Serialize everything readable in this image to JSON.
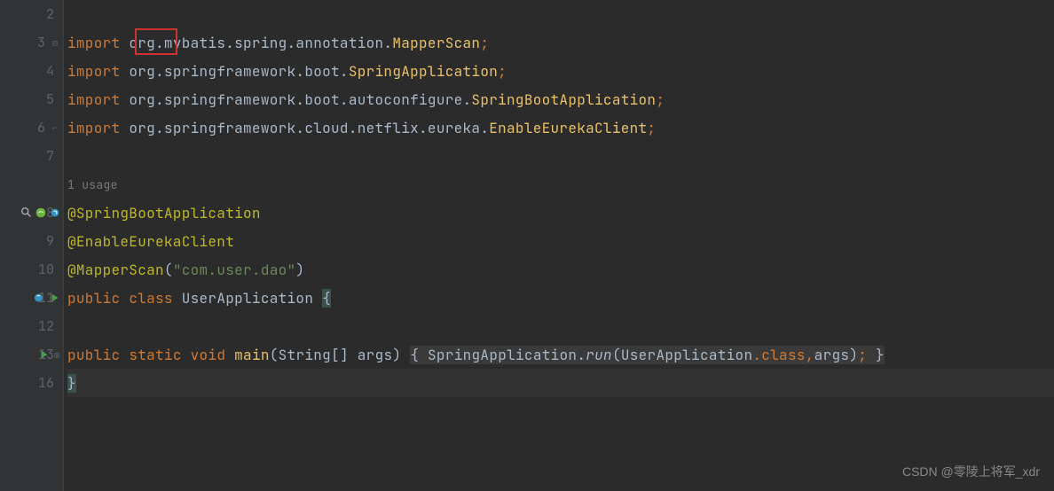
{
  "lines": [
    {
      "num": "2",
      "content": ""
    },
    {
      "num": "3",
      "content": "import_line",
      "parts": [
        "import ",
        "org",
        ".mybatis.spring.annotation.",
        "MapperScan",
        ";"
      ],
      "fold": "minus"
    },
    {
      "num": "4",
      "content": "import_line",
      "parts": [
        "import ",
        "org.springframework.boot.",
        "SpringApplication",
        ";"
      ]
    },
    {
      "num": "5",
      "content": "import_line",
      "parts": [
        "import ",
        "org.springframework.boot.autoconfigure.",
        "SpringBootApplication",
        ";"
      ]
    },
    {
      "num": "6",
      "content": "import_line",
      "parts": [
        "import ",
        "org.springframework.cloud.netflix.eureka.",
        "EnableEurekaClient",
        ";"
      ],
      "fold": "end"
    },
    {
      "num": "7",
      "content": ""
    },
    {
      "num": "",
      "content": "usage_hint"
    },
    {
      "num": "8",
      "content": "annotation",
      "icons": [
        "search",
        "leaf",
        "refresh"
      ],
      "fold": "minus"
    },
    {
      "num": "9",
      "content": "annotation2"
    },
    {
      "num": "10",
      "content": "annotation3"
    },
    {
      "num": "11",
      "content": "class_decl",
      "icons": [
        "refresh2",
        "run"
      ]
    },
    {
      "num": "12",
      "content": ""
    },
    {
      "num": "13",
      "content": "main_method",
      "icons": [
        "run"
      ],
      "fold": "plus"
    },
    {
      "num": "16",
      "content": "close_brace",
      "caret": true
    }
  ],
  "code": {
    "import_kw": "import ",
    "line3_pkg1": "org",
    "line3_pkg2": ".mybatis.spring.annotation.",
    "line3_cls": "MapperScan",
    "semi": ";",
    "line4_pkg": "org.springframework.boot.",
    "line4_cls": "SpringApplication",
    "line5_pkg": "org.springframework.boot.autoconfigure.",
    "line5_cls": "SpringBootApplication",
    "line6_pkg": "org.springframework.cloud.netflix.eureka.",
    "line6_cls": "EnableEurekaClient",
    "usage_hint": "1 usage",
    "ann1": "@SpringBootApplication",
    "ann2": "@EnableEurekaClient",
    "ann3_name": "@MapperScan",
    "ann3_open": "(",
    "ann3_str": "\"com.user.dao\"",
    "ann3_close": ")",
    "public_kw": "public ",
    "class_kw": "class ",
    "class_name": "UserApplication ",
    "open_brace": "{",
    "static_kw": "static ",
    "void_kw": "void ",
    "main_name": "main",
    "main_params_open": "(",
    "string_type": "String",
    "brackets": "[]",
    "args_param": " args",
    "main_params_close": ") ",
    "fold_open": "{ ",
    "spring_app": "SpringApplication",
    "dot": ".",
    "run_method": "run",
    "run_open": "(",
    "user_app": "UserApplication",
    "class_ref": ".class",
    "comma": ",",
    "args_ref": "args",
    "run_close": ")",
    "stmt_end": "; ",
    "fold_close": "}",
    "close_brace": "}"
  },
  "watermark": "CSDN @零陵上将军_xdr"
}
